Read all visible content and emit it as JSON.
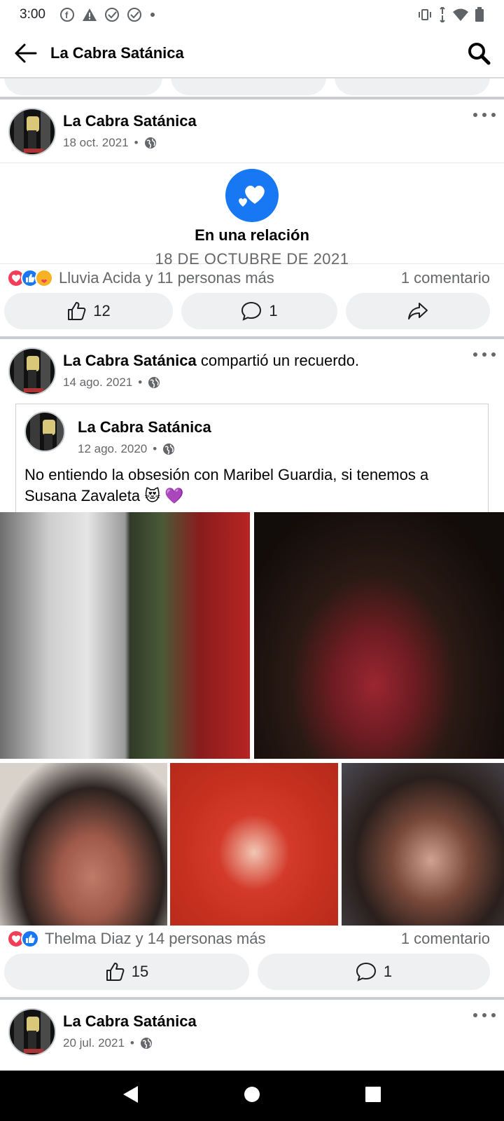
{
  "status_bar": {
    "time": "3:00"
  },
  "header": {
    "title": "La Cabra Satánica"
  },
  "post1": {
    "author": "La Cabra Satánica",
    "date": "18 oct. 2021",
    "event_title": "En una relación",
    "event_date": "18 DE OCTUBRE DE 2021",
    "reactions_text": "Lluvia Acida y 11 personas más",
    "comments_text": "1 comentario",
    "like_count": "12",
    "comment_count": "1"
  },
  "post2": {
    "author": "La Cabra Satánica",
    "action": "compartió un recuerdo.",
    "date": "14 ago. 2021",
    "shared_author": "La Cabra Satánica",
    "shared_date": "12 ago. 2020",
    "shared_text": "No entiendo la obsesión con Maribel Guardia, si tenemos a Susana Zavaleta 😻 💜",
    "reactions_text": "Thelma Diaz y 14 personas más",
    "comments_text": "1 comentario",
    "like_count": "15",
    "comment_count": "1"
  },
  "post3": {
    "author": "La Cabra Satánica",
    "date": "20 jul. 2021"
  },
  "colors": {
    "facebook_blue": "#1877f2",
    "love_red": "#f33e58"
  }
}
